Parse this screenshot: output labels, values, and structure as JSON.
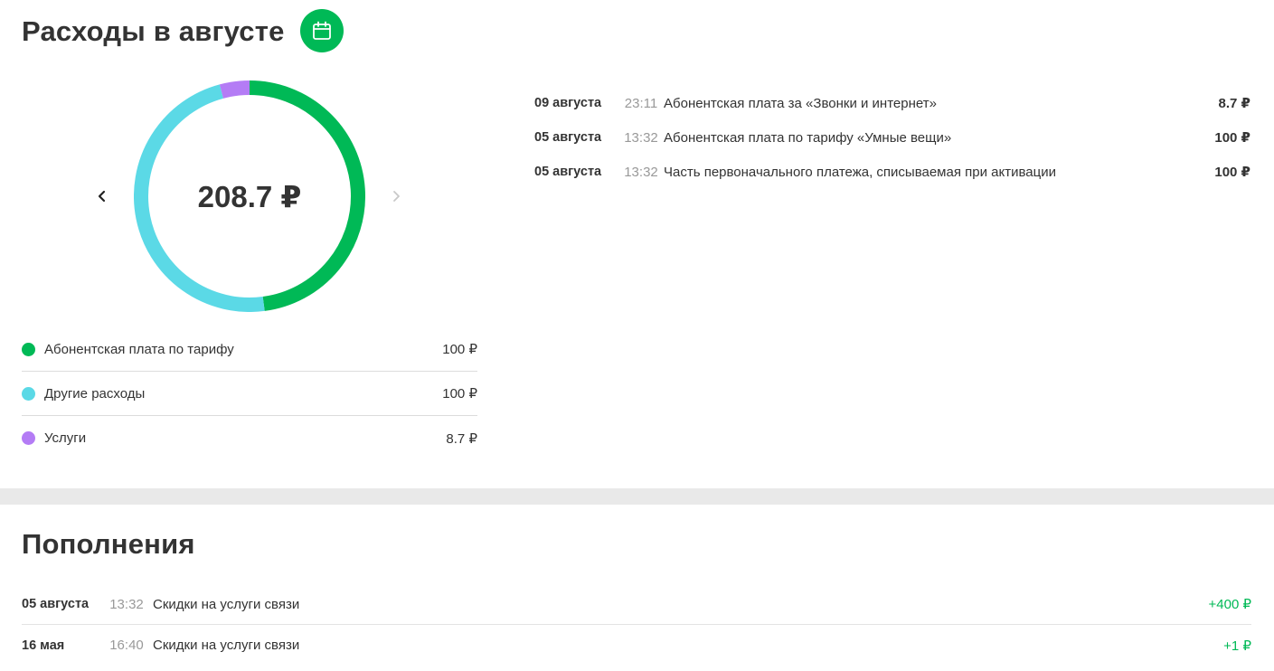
{
  "expenses": {
    "title": "Расходы в августе",
    "calendar_icon": "calendar-icon",
    "total": "208.7 ₽",
    "colors": {
      "green": "#00b956",
      "cyan": "#5bd9e6",
      "purple": "#b47cf5"
    },
    "breakdown": [
      {
        "label": "Абонентская плата по тарифу",
        "amount": "100 ₽",
        "value": 100,
        "color": "#00b956"
      },
      {
        "label": "Другие расходы",
        "amount": "100 ₽",
        "value": 100,
        "color": "#5bd9e6"
      },
      {
        "label": "Услуги",
        "amount": "8.7 ₽",
        "value": 8.7,
        "color": "#b47cf5"
      }
    ],
    "transactions": [
      {
        "date": "09 августа",
        "time": "23:11",
        "description": "Абонентская плата за «Звонки и интернет»",
        "amount": "8.7 ₽"
      },
      {
        "date": "05 августа",
        "time": "13:32",
        "description": "Абонентская плата по тарифу «Умные вещи»",
        "amount": "100 ₽"
      },
      {
        "date": "05 августа",
        "time": "13:32",
        "description": "Часть первоначального платежа, списываемая при активации",
        "amount": "100 ₽"
      }
    ]
  },
  "topups": {
    "title": "Пополнения",
    "items": [
      {
        "date": "05 августа",
        "time": "13:32",
        "description": "Скидки на услуги связи",
        "amount": "+400 ₽"
      },
      {
        "date": "16 мая",
        "time": "16:40",
        "description": "Скидки на услуги связи",
        "amount": "+1 ₽"
      }
    ]
  }
}
